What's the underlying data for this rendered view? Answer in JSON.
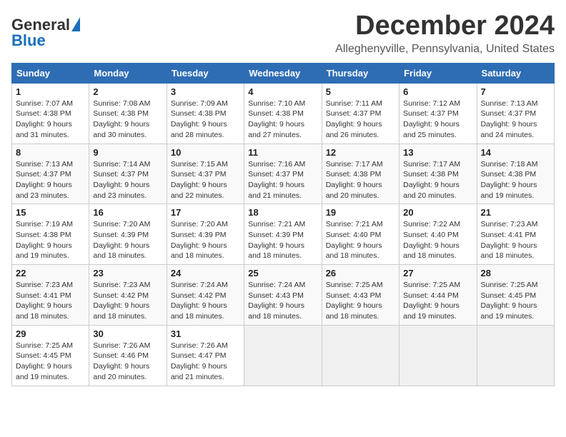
{
  "logo": {
    "general": "General",
    "blue": "Blue"
  },
  "title": "December 2024",
  "location": "Alleghenyville, Pennsylvania, United States",
  "days_of_week": [
    "Sunday",
    "Monday",
    "Tuesday",
    "Wednesday",
    "Thursday",
    "Friday",
    "Saturday"
  ],
  "weeks": [
    [
      {
        "day": "1",
        "sunrise": "7:07 AM",
        "sunset": "4:38 PM",
        "daylight": "9 hours and 31 minutes."
      },
      {
        "day": "2",
        "sunrise": "7:08 AM",
        "sunset": "4:38 PM",
        "daylight": "9 hours and 30 minutes."
      },
      {
        "day": "3",
        "sunrise": "7:09 AM",
        "sunset": "4:38 PM",
        "daylight": "9 hours and 28 minutes."
      },
      {
        "day": "4",
        "sunrise": "7:10 AM",
        "sunset": "4:38 PM",
        "daylight": "9 hours and 27 minutes."
      },
      {
        "day": "5",
        "sunrise": "7:11 AM",
        "sunset": "4:37 PM",
        "daylight": "9 hours and 26 minutes."
      },
      {
        "day": "6",
        "sunrise": "7:12 AM",
        "sunset": "4:37 PM",
        "daylight": "9 hours and 25 minutes."
      },
      {
        "day": "7",
        "sunrise": "7:13 AM",
        "sunset": "4:37 PM",
        "daylight": "9 hours and 24 minutes."
      }
    ],
    [
      {
        "day": "8",
        "sunrise": "7:13 AM",
        "sunset": "4:37 PM",
        "daylight": "9 hours and 23 minutes."
      },
      {
        "day": "9",
        "sunrise": "7:14 AM",
        "sunset": "4:37 PM",
        "daylight": "9 hours and 23 minutes."
      },
      {
        "day": "10",
        "sunrise": "7:15 AM",
        "sunset": "4:37 PM",
        "daylight": "9 hours and 22 minutes."
      },
      {
        "day": "11",
        "sunrise": "7:16 AM",
        "sunset": "4:37 PM",
        "daylight": "9 hours and 21 minutes."
      },
      {
        "day": "12",
        "sunrise": "7:17 AM",
        "sunset": "4:38 PM",
        "daylight": "9 hours and 20 minutes."
      },
      {
        "day": "13",
        "sunrise": "7:17 AM",
        "sunset": "4:38 PM",
        "daylight": "9 hours and 20 minutes."
      },
      {
        "day": "14",
        "sunrise": "7:18 AM",
        "sunset": "4:38 PM",
        "daylight": "9 hours and 19 minutes."
      }
    ],
    [
      {
        "day": "15",
        "sunrise": "7:19 AM",
        "sunset": "4:38 PM",
        "daylight": "9 hours and 19 minutes."
      },
      {
        "day": "16",
        "sunrise": "7:20 AM",
        "sunset": "4:39 PM",
        "daylight": "9 hours and 18 minutes."
      },
      {
        "day": "17",
        "sunrise": "7:20 AM",
        "sunset": "4:39 PM",
        "daylight": "9 hours and 18 minutes."
      },
      {
        "day": "18",
        "sunrise": "7:21 AM",
        "sunset": "4:39 PM",
        "daylight": "9 hours and 18 minutes."
      },
      {
        "day": "19",
        "sunrise": "7:21 AM",
        "sunset": "4:40 PM",
        "daylight": "9 hours and 18 minutes."
      },
      {
        "day": "20",
        "sunrise": "7:22 AM",
        "sunset": "4:40 PM",
        "daylight": "9 hours and 18 minutes."
      },
      {
        "day": "21",
        "sunrise": "7:23 AM",
        "sunset": "4:41 PM",
        "daylight": "9 hours and 18 minutes."
      }
    ],
    [
      {
        "day": "22",
        "sunrise": "7:23 AM",
        "sunset": "4:41 PM",
        "daylight": "9 hours and 18 minutes."
      },
      {
        "day": "23",
        "sunrise": "7:23 AM",
        "sunset": "4:42 PM",
        "daylight": "9 hours and 18 minutes."
      },
      {
        "day": "24",
        "sunrise": "7:24 AM",
        "sunset": "4:42 PM",
        "daylight": "9 hours and 18 minutes."
      },
      {
        "day": "25",
        "sunrise": "7:24 AM",
        "sunset": "4:43 PM",
        "daylight": "9 hours and 18 minutes."
      },
      {
        "day": "26",
        "sunrise": "7:25 AM",
        "sunset": "4:43 PM",
        "daylight": "9 hours and 18 minutes."
      },
      {
        "day": "27",
        "sunrise": "7:25 AM",
        "sunset": "4:44 PM",
        "daylight": "9 hours and 19 minutes."
      },
      {
        "day": "28",
        "sunrise": "7:25 AM",
        "sunset": "4:45 PM",
        "daylight": "9 hours and 19 minutes."
      }
    ],
    [
      {
        "day": "29",
        "sunrise": "7:25 AM",
        "sunset": "4:45 PM",
        "daylight": "9 hours and 19 minutes."
      },
      {
        "day": "30",
        "sunrise": "7:26 AM",
        "sunset": "4:46 PM",
        "daylight": "9 hours and 20 minutes."
      },
      {
        "day": "31",
        "sunrise": "7:26 AM",
        "sunset": "4:47 PM",
        "daylight": "9 hours and 21 minutes."
      },
      null,
      null,
      null,
      null
    ]
  ]
}
